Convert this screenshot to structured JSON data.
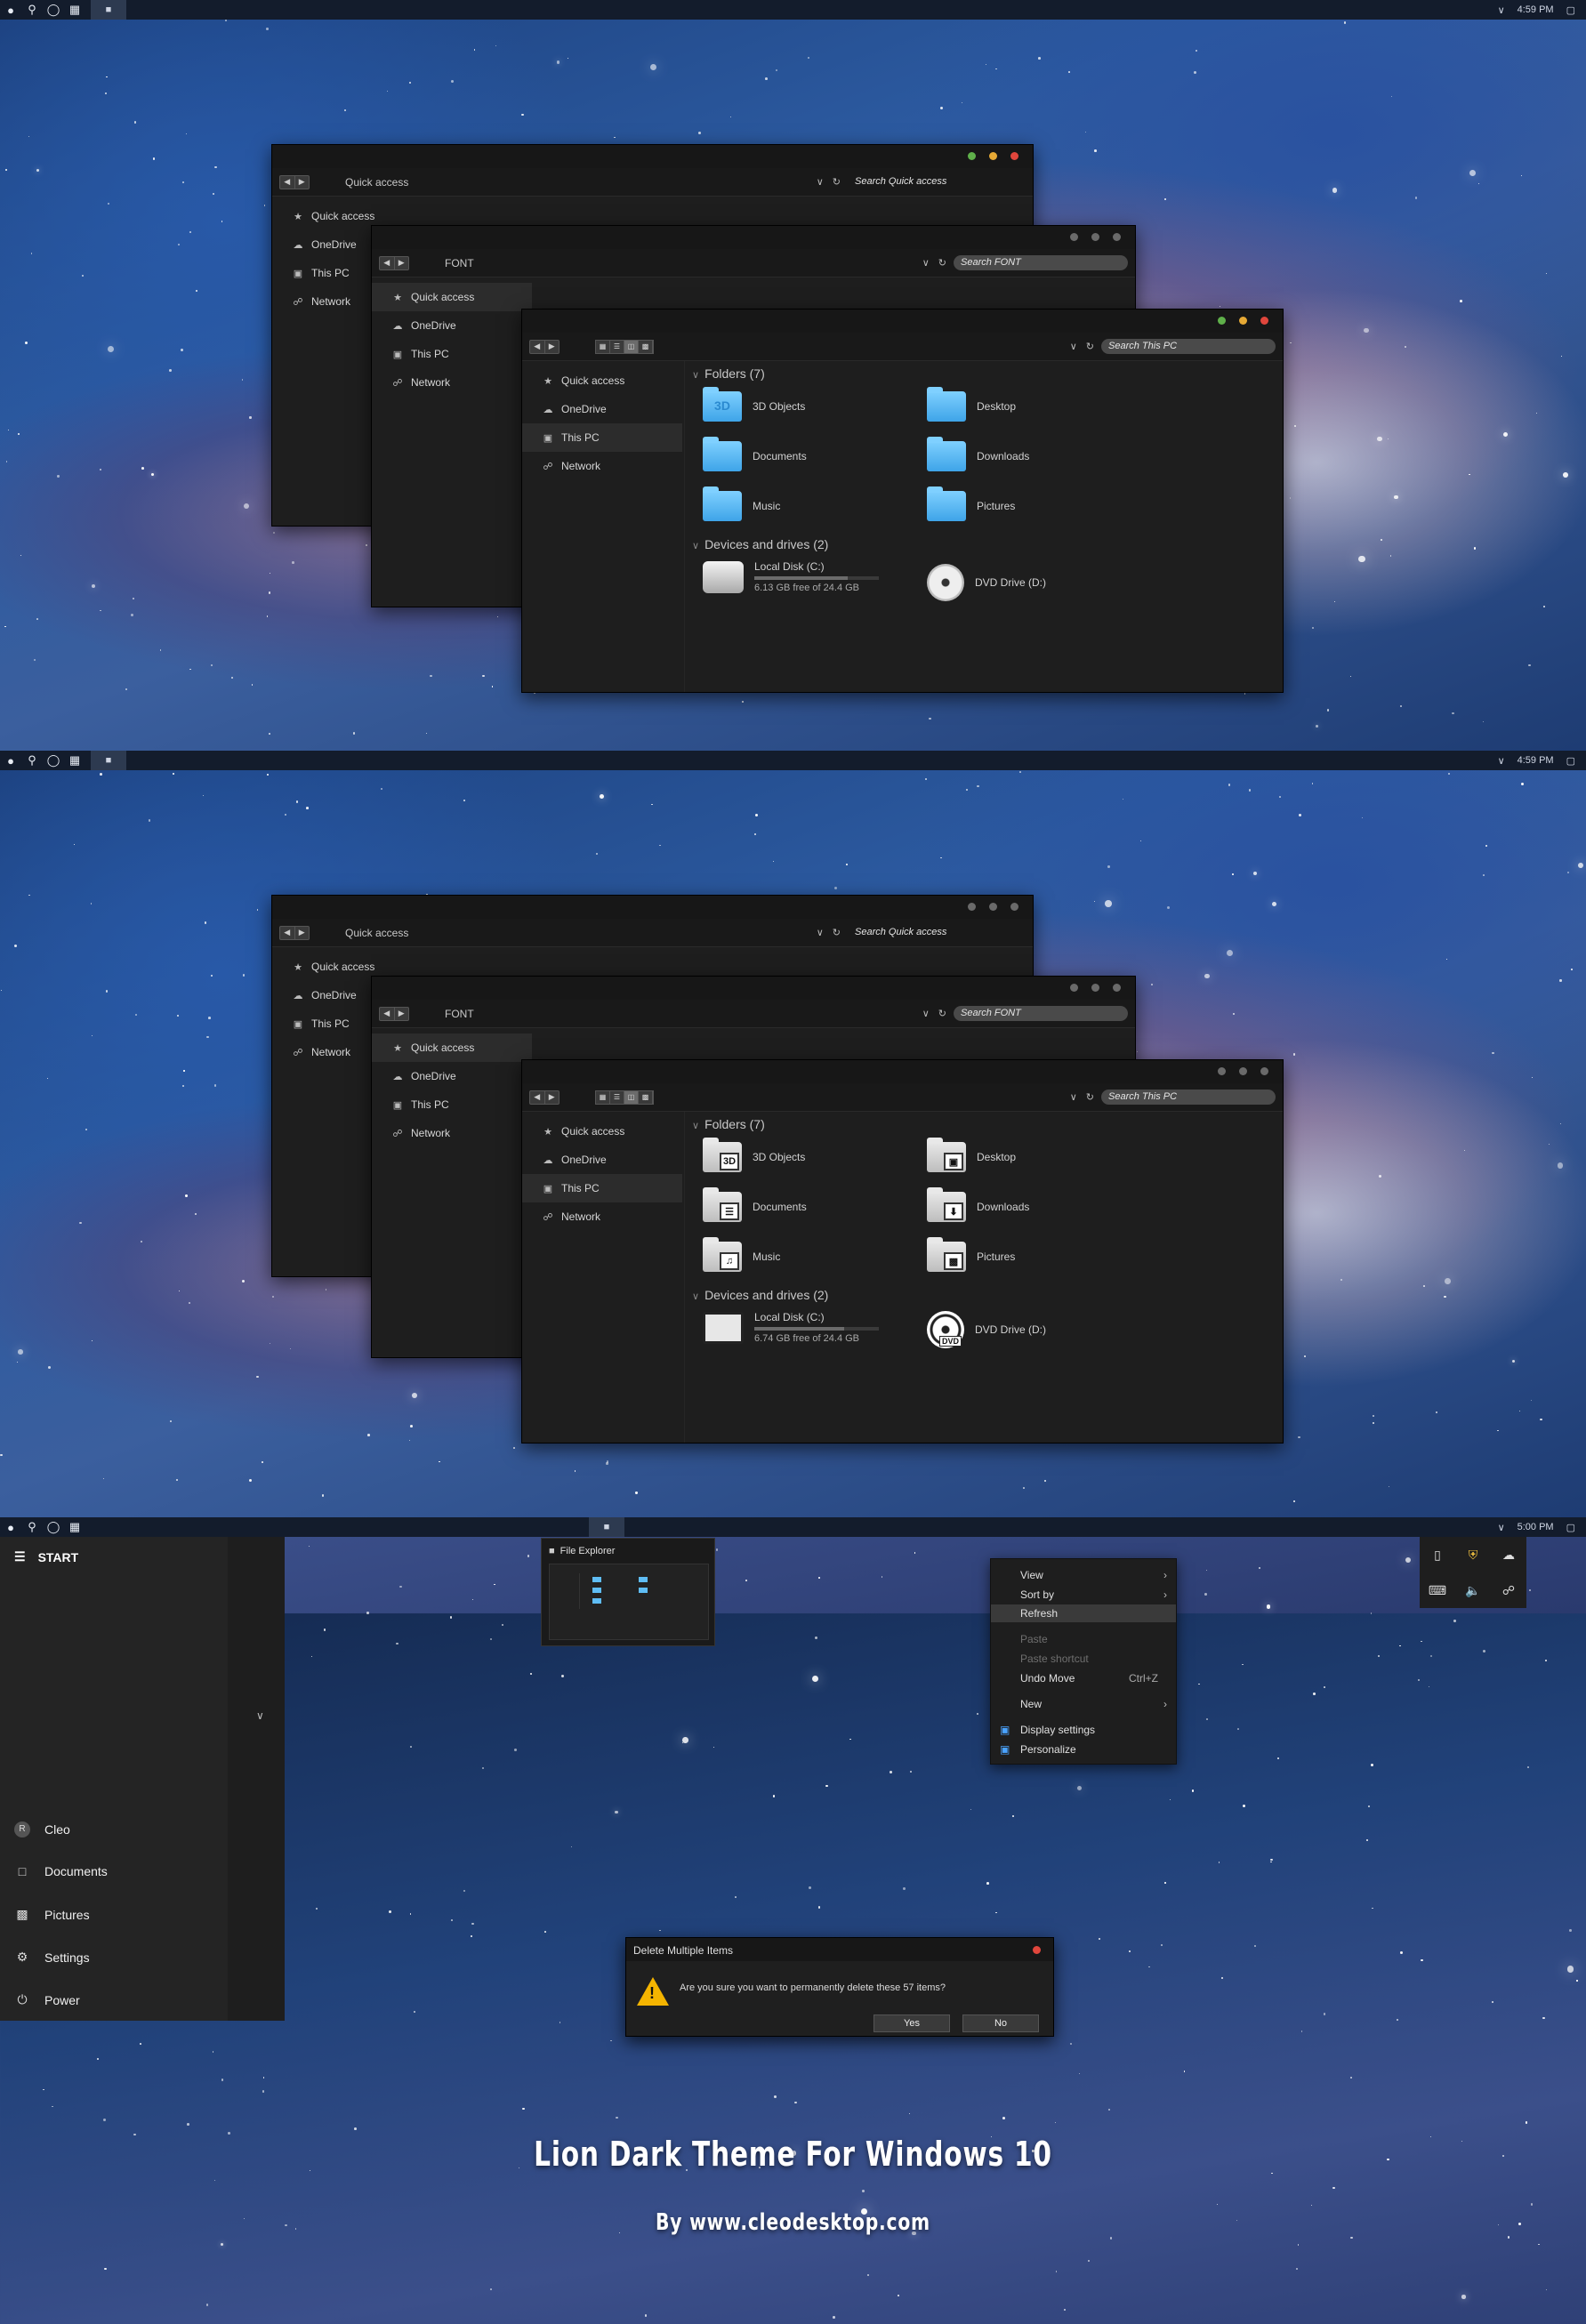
{
  "colors": {
    "dot_green": "#5fb04a",
    "dot_yellow": "#e6a935",
    "dot_red": "#e0463c",
    "dot_gray": "#6a6a6a",
    "folder_blue": "#5fbdf5"
  },
  "icons": {
    "apple": "apple-icon",
    "search": "search-icon",
    "cortana": "circle-icon",
    "taskview": "task-view-icon",
    "explorer": "folder-icon",
    "notification": "notification-icon",
    "chevron": "chevron-up-icon"
  },
  "topbar": {
    "clock_1": "4:59 PM",
    "clock_2": "4:59 PM",
    "clock_3": "5:00 PM"
  },
  "window_back": {
    "path": "Quick access",
    "search": "Search Quick access"
  },
  "window_mid": {
    "path": "FONT",
    "search": "Search FONT"
  },
  "window_front": {
    "search": "Search This PC"
  },
  "sidebar": {
    "quick_access": "Quick access",
    "onedrive": "OneDrive",
    "this_pc": "This PC",
    "network": "Network"
  },
  "folders": {
    "header": "Folders (7)",
    "f3d": "3D Objects",
    "desktop": "Desktop",
    "documents": "Documents",
    "downloads": "Downloads",
    "music": "Music",
    "pictures": "Pictures",
    "badge_3d": "3D"
  },
  "drives": {
    "header": "Devices and drives (2)",
    "local": "Local Disk (C:)",
    "free_1": "6.13 GB free of 24.4 GB",
    "free_2": "6.74 GB free of 24.4 GB",
    "used_fraction_1": 0.749,
    "used_fraction_2": 0.724,
    "dvd": "DVD Drive (D:)",
    "dvd_badge": "DVD"
  },
  "start": {
    "title": "START",
    "user": "Cleo",
    "user_initial": "R",
    "documents": "Documents",
    "pictures": "Pictures",
    "settings": "Settings",
    "power": "Power"
  },
  "thumbnail": {
    "title": "File Explorer"
  },
  "context_menu": {
    "view": "View",
    "sort_by": "Sort by",
    "refresh": "Refresh",
    "paste": "Paste",
    "paste_shortcut": "Paste shortcut",
    "undo_move": "Undo Move",
    "undo_shortcut": "Ctrl+Z",
    "new": "New",
    "display_settings": "Display settings",
    "personalize": "Personalize"
  },
  "dialog": {
    "title": "Delete Multiple Items",
    "message": "Are you sure you want to permanently delete these 57 items?",
    "yes": "Yes",
    "no": "No"
  },
  "promo": {
    "title": "Lion Dark Theme For Windows 10",
    "byline": "By www.cleodesktop.com"
  }
}
